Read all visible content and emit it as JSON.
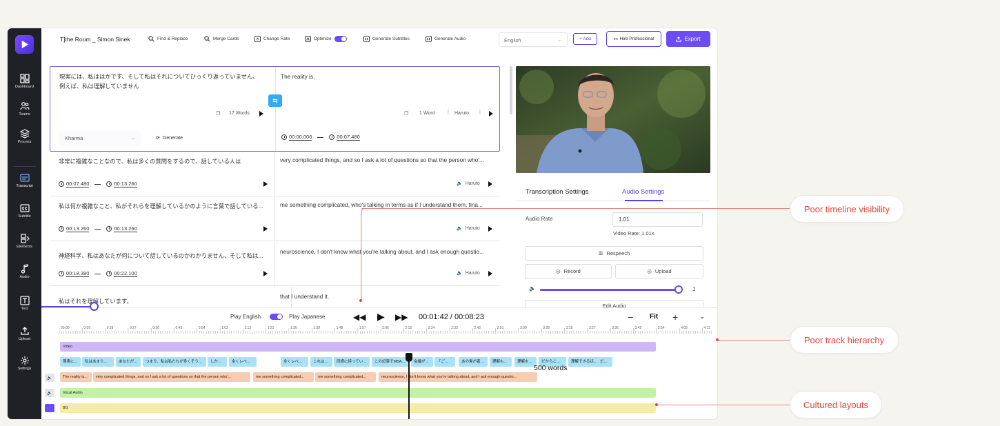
{
  "sidebar": {
    "items": [
      {
        "label": "Dashboard",
        "icon": "dashboard-icon"
      },
      {
        "label": "Teams",
        "icon": "teams-icon"
      },
      {
        "label": "Process",
        "icon": "process-icon"
      },
      {
        "label": "Transcript",
        "icon": "transcript-icon"
      },
      {
        "label": "Subtitle",
        "icon": "subtitle-icon"
      },
      {
        "label": "Elements",
        "icon": "elements-icon"
      },
      {
        "label": "Audio",
        "icon": "audio-icon"
      },
      {
        "label": "Text",
        "icon": "text-icon"
      },
      {
        "label": "Upload",
        "icon": "upload-icon"
      },
      {
        "label": "Settings",
        "icon": "settings-icon"
      }
    ],
    "active": "Transcript"
  },
  "toolbar": {
    "title": "T]the Room _ Simon Sinek",
    "find_replace": "Find & Replace",
    "merge_cards": "Merge Cards",
    "change_rate": "Change Rate",
    "optimize": "Optimize",
    "generate_subtitles": "Generate Subtitles",
    "generate_audio": "Generate Audio",
    "language": "English",
    "add": "+ Add",
    "hire": "Hire Professional",
    "export": "Export"
  },
  "cards": [
    {
      "src": "現実には、私ははかです、そして私はそれについてひっくり返っていません、例えば、私は理解していません",
      "tgt": "The reality is,",
      "src_words": "17 Words",
      "tgt_words": "1 Word",
      "voice": "Haruto",
      "voice_select": "Kharma",
      "generate": "Generate",
      "start": "00:00.000",
      "end": "00:07.480"
    },
    {
      "src": "非常に複雑なことなので、私は多くの質問をするので、話している人は",
      "tgt": "very complicated things, and so I ask a lot of questions so that the person who'...",
      "start": "00:07.480",
      "end": "00:13.260",
      "voice": "Haruto"
    },
    {
      "src": "私は何か複雑なこと、私がそれらを理解しているかのように言葉で話している...",
      "tgt": "me something complicated, who's talking in terms as if I understand them, fina...",
      "start": "00:13.260",
      "end": "00:13.260",
      "voice": "Haruto"
    },
    {
      "src": "神経科学、私はあなたが何について話しているのかわかりません、そして私は...",
      "tgt": "neuroscience, I don't know what you're talking about, and I ask enough questio...",
      "start": "00:18.380",
      "end": "00:22.100",
      "voice": "Haruto"
    },
    {
      "src": "私はそれを理解しています。",
      "tgt": "that I understand it."
    }
  ],
  "settings": {
    "tab_transcription": "Transcription Settings",
    "tab_audio": "Audio Settings",
    "audio_rate_label": "Audio Rate",
    "audio_rate_value": "1.01",
    "video_rate": "Video Rate: 1.01x",
    "respeech": "Respeech",
    "record": "Record",
    "upload": "Upload",
    "volume_value": "1",
    "volume_level": 1.0,
    "edit_audio": "Edit Audio"
  },
  "player": {
    "play_english": "Play English",
    "play_japanese": "Play Japanese",
    "time": "00:01:42 / 00:08:23",
    "fit": "Fit",
    "words": "500 words"
  },
  "ruler_ticks": [
    "00:00",
    "0:09",
    "0:18",
    "0:27",
    "0:36",
    "0:45",
    "0:54",
    "1:03",
    "1:12",
    "1:21",
    "1:30",
    "1:39",
    "1:48",
    "1:57",
    "2:06",
    "2:15",
    "2:24",
    "2:33",
    "2:42",
    "2:51",
    "3:00",
    "3:09",
    "3:18",
    "3:27",
    "3:36",
    "3:45",
    "3:54",
    "4:03",
    "4:12"
  ],
  "tracks": {
    "video_label": "Video",
    "jp_clips": [
      "現実に...",
      "私はあまり複雑...",
      "あなたが...",
      "つまり、私は私たちが多くそうです...",
      "しかし...",
      "全くレベル枠...",
      "全くレベル枠...",
      "これは、私の小...",
      "同様に持っていた...",
      "この記事でMBAの...",
      "会議が進...",
      "「ごめん...",
      "あの貴が者が...",
      "理解も使わ",
      "理解を使わ",
      "だからこそ...",
      "理解できるほど...",
      "だから"
    ],
    "en_clips": [
      "The reality is...",
      "very complicated things, and so I ask a lot of questions so that the person who'...",
      "me something complicated...",
      "me something complicated...",
      "neuroscience, I don't know what you're talking about, and I ask enough questio..."
    ],
    "vocal_label": "Vocal Audio",
    "bg_label": "BG"
  },
  "callouts": [
    {
      "text": "Poor timeline visibility"
    },
    {
      "text": "Poor track hierarchy"
    },
    {
      "text": "Cultured layouts"
    }
  ]
}
